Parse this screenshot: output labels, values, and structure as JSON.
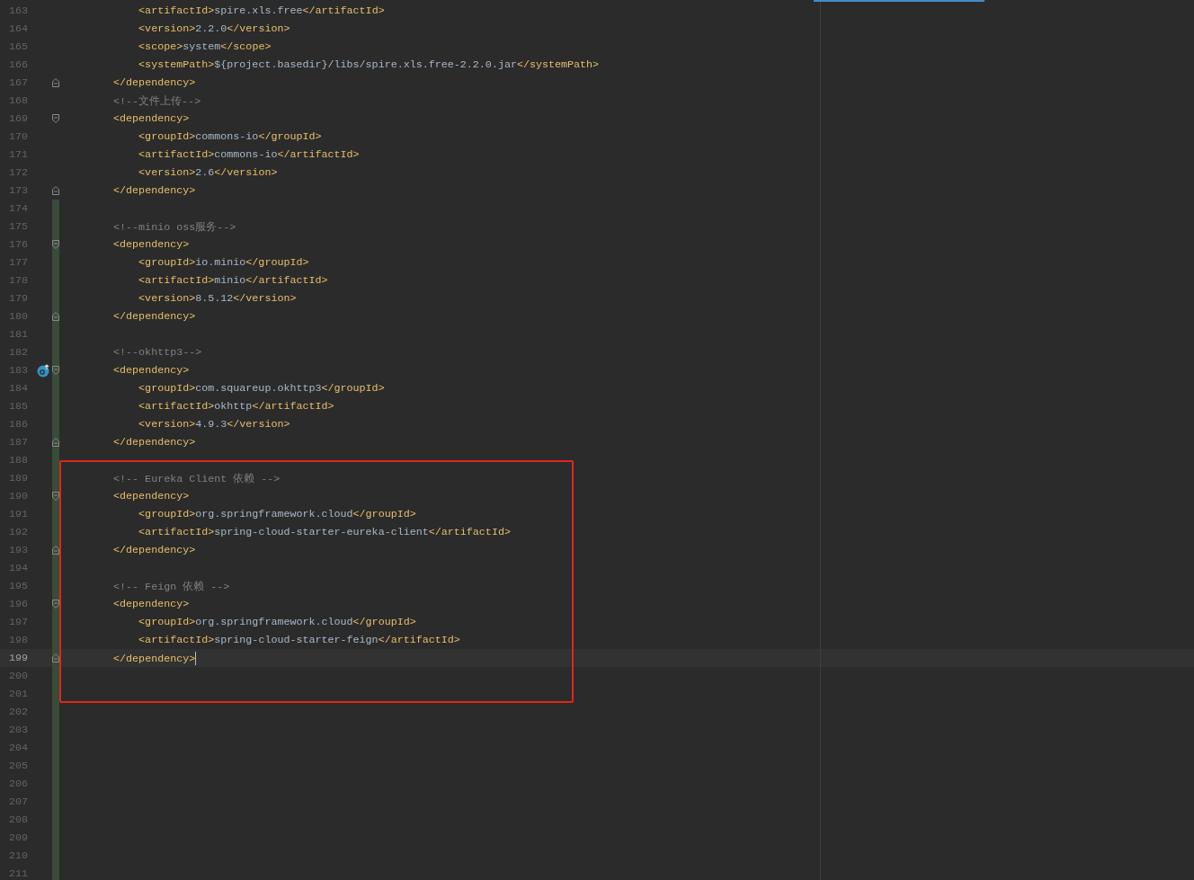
{
  "editor": {
    "lines": [
      {
        "number": "163",
        "kind": "xml",
        "code": "        <artifactId>spire.xls.free</artifactId>",
        "fold_start": false,
        "fold_end": false,
        "changed": false,
        "marker": false,
        "selected": false,
        "caret": false
      },
      {
        "number": "164",
        "kind": "xml",
        "code": "        <version>2.2.0</version>",
        "fold_start": false,
        "fold_end": false,
        "changed": false,
        "marker": false,
        "selected": false,
        "caret": false
      },
      {
        "number": "165",
        "kind": "xml",
        "code": "        <scope>system</scope>",
        "fold_start": false,
        "fold_end": false,
        "changed": false,
        "marker": false,
        "selected": false,
        "caret": false
      },
      {
        "number": "166",
        "kind": "xml",
        "code": "        <systemPath>${project.basedir}/libs/spire.xls.free-2.2.0.jar</systemPath>",
        "fold_start": false,
        "fold_end": false,
        "changed": false,
        "marker": false,
        "selected": false,
        "caret": false
      },
      {
        "number": "167",
        "kind": "xml",
        "code": "    </dependency>",
        "fold_start": false,
        "fold_end": true,
        "changed": false,
        "marker": false,
        "selected": false,
        "caret": false
      },
      {
        "number": "168",
        "kind": "comment",
        "code": "    <!--文件上传-->",
        "fold_start": false,
        "fold_end": false,
        "changed": false,
        "marker": false,
        "selected": false,
        "caret": false
      },
      {
        "number": "169",
        "kind": "xml",
        "code": "    <dependency>",
        "fold_start": true,
        "fold_end": false,
        "changed": false,
        "marker": false,
        "selected": false,
        "caret": false
      },
      {
        "number": "170",
        "kind": "xml",
        "code": "        <groupId>commons-io</groupId>",
        "fold_start": false,
        "fold_end": false,
        "changed": false,
        "marker": false,
        "selected": false,
        "caret": false
      },
      {
        "number": "171",
        "kind": "xml",
        "code": "        <artifactId>commons-io</artifactId>",
        "fold_start": false,
        "fold_end": false,
        "changed": false,
        "marker": false,
        "selected": false,
        "caret": false
      },
      {
        "number": "172",
        "kind": "xml",
        "code": "        <version>2.6</version>",
        "fold_start": false,
        "fold_end": false,
        "changed": false,
        "marker": false,
        "selected": false,
        "caret": false
      },
      {
        "number": "173",
        "kind": "xml",
        "code": "    </dependency>",
        "fold_start": false,
        "fold_end": true,
        "changed": false,
        "marker": false,
        "selected": false,
        "caret": false
      },
      {
        "number": "174",
        "kind": "blank",
        "fold_start": false,
        "fold_end": false,
        "changed": true,
        "marker": false,
        "selected": false,
        "caret": false
      },
      {
        "number": "175",
        "kind": "comment",
        "code": "    <!--minio oss服务-->",
        "fold_start": false,
        "fold_end": false,
        "changed": true,
        "marker": false,
        "selected": false,
        "caret": false
      },
      {
        "number": "176",
        "kind": "xml",
        "code": "    <dependency>",
        "fold_start": true,
        "fold_end": false,
        "changed": true,
        "marker": false,
        "selected": false,
        "caret": false
      },
      {
        "number": "177",
        "kind": "xml",
        "code": "        <groupId>io.minio</groupId>",
        "fold_start": false,
        "fold_end": false,
        "changed": true,
        "marker": false,
        "selected": false,
        "caret": false
      },
      {
        "number": "178",
        "kind": "xml",
        "code": "        <artifactId>minio</artifactId>",
        "fold_start": false,
        "fold_end": false,
        "changed": true,
        "marker": false,
        "selected": false,
        "caret": false
      },
      {
        "number": "179",
        "kind": "xml",
        "code": "        <version>8.5.12</version>",
        "fold_start": false,
        "fold_end": false,
        "changed": true,
        "marker": false,
        "selected": false,
        "caret": false
      },
      {
        "number": "180",
        "kind": "xml",
        "code": "    </dependency>",
        "fold_start": false,
        "fold_end": true,
        "changed": true,
        "marker": false,
        "selected": false,
        "caret": false
      },
      {
        "number": "181",
        "kind": "blank",
        "fold_start": false,
        "fold_end": false,
        "changed": true,
        "marker": false,
        "selected": false,
        "caret": false
      },
      {
        "number": "182",
        "kind": "comment",
        "code": "    <!--okhttp3-->",
        "fold_start": false,
        "fold_end": false,
        "changed": true,
        "marker": false,
        "selected": false,
        "caret": false
      },
      {
        "number": "183",
        "kind": "xml",
        "code": "    <dependency>",
        "fold_start": true,
        "fold_end": false,
        "changed": true,
        "marker": true,
        "selected": false,
        "caret": false
      },
      {
        "number": "184",
        "kind": "xml",
        "code": "        <groupId>com.squareup.okhttp3</groupId>",
        "fold_start": false,
        "fold_end": false,
        "changed": true,
        "marker": false,
        "selected": false,
        "caret": false
      },
      {
        "number": "185",
        "kind": "xml",
        "code": "        <artifactId>okhttp</artifactId>",
        "fold_start": false,
        "fold_end": false,
        "changed": true,
        "marker": false,
        "selected": false,
        "caret": false
      },
      {
        "number": "186",
        "kind": "xml",
        "code": "        <version>4.9.3</version>",
        "fold_start": false,
        "fold_end": false,
        "changed": true,
        "marker": false,
        "selected": false,
        "caret": false
      },
      {
        "number": "187",
        "kind": "xml",
        "code": "    </dependency>",
        "fold_start": false,
        "fold_end": true,
        "changed": true,
        "marker": false,
        "selected": false,
        "caret": false
      },
      {
        "number": "188",
        "kind": "blank",
        "fold_start": false,
        "fold_end": false,
        "changed": true,
        "marker": false,
        "selected": false,
        "caret": false
      },
      {
        "number": "189",
        "kind": "comment",
        "code": "    <!-- Eureka Client 依赖 -->",
        "fold_start": false,
        "fold_end": false,
        "changed": true,
        "marker": false,
        "selected": false,
        "caret": false
      },
      {
        "number": "190",
        "kind": "xml",
        "code": "    <dependency>",
        "fold_start": true,
        "fold_end": false,
        "changed": true,
        "marker": false,
        "selected": false,
        "caret": false
      },
      {
        "number": "191",
        "kind": "xml",
        "code": "        <groupId>org.springframework.cloud</groupId>",
        "fold_start": false,
        "fold_end": false,
        "changed": true,
        "marker": false,
        "selected": false,
        "caret": false
      },
      {
        "number": "192",
        "kind": "xml",
        "code": "        <artifactId>spring-cloud-starter-eureka-client</artifactId>",
        "fold_start": false,
        "fold_end": false,
        "changed": true,
        "marker": false,
        "selected": false,
        "caret": false
      },
      {
        "number": "193",
        "kind": "xml",
        "code": "    </dependency>",
        "fold_start": false,
        "fold_end": true,
        "changed": true,
        "marker": false,
        "selected": false,
        "caret": false
      },
      {
        "number": "194",
        "kind": "blank",
        "fold_start": false,
        "fold_end": false,
        "changed": true,
        "marker": false,
        "selected": false,
        "caret": false
      },
      {
        "number": "195",
        "kind": "comment",
        "code": "    <!-- Feign 依赖 -->",
        "fold_start": false,
        "fold_end": false,
        "changed": true,
        "marker": false,
        "selected": false,
        "caret": false
      },
      {
        "number": "196",
        "kind": "xml",
        "code": "    <dependency>",
        "fold_start": true,
        "fold_end": false,
        "changed": true,
        "marker": false,
        "selected": false,
        "caret": false
      },
      {
        "number": "197",
        "kind": "xml",
        "code": "        <groupId>org.springframework.cloud</groupId>",
        "fold_start": false,
        "fold_end": false,
        "changed": true,
        "marker": false,
        "selected": false,
        "caret": false
      },
      {
        "number": "198",
        "kind": "xml",
        "code": "        <artifactId>spring-cloud-starter-feign</artifactId>",
        "fold_start": false,
        "fold_end": false,
        "changed": true,
        "marker": false,
        "selected": false,
        "caret": false
      },
      {
        "number": "199",
        "kind": "xml",
        "code": "    </dependency>",
        "fold_start": false,
        "fold_end": true,
        "changed": true,
        "marker": false,
        "selected": true,
        "caret": true
      },
      {
        "number": "200",
        "kind": "blank",
        "fold_start": false,
        "fold_end": false,
        "changed": true,
        "marker": false,
        "selected": false,
        "caret": false
      },
      {
        "number": "201",
        "kind": "blank",
        "fold_start": false,
        "fold_end": false,
        "changed": true,
        "marker": false,
        "selected": false,
        "caret": false
      },
      {
        "number": "202",
        "kind": "blank",
        "fold_start": false,
        "fold_end": false,
        "changed": true,
        "marker": false,
        "selected": false,
        "caret": false
      },
      {
        "number": "203",
        "kind": "blank",
        "fold_start": false,
        "fold_end": false,
        "changed": true,
        "marker": false,
        "selected": false,
        "caret": false
      },
      {
        "number": "204",
        "kind": "blank",
        "fold_start": false,
        "fold_end": false,
        "changed": true,
        "marker": false,
        "selected": false,
        "caret": false
      },
      {
        "number": "205",
        "kind": "blank",
        "fold_start": false,
        "fold_end": false,
        "changed": true,
        "marker": false,
        "selected": false,
        "caret": false
      },
      {
        "number": "206",
        "kind": "blank",
        "fold_start": false,
        "fold_end": false,
        "changed": true,
        "marker": false,
        "selected": false,
        "caret": false
      },
      {
        "number": "207",
        "kind": "blank",
        "fold_start": false,
        "fold_end": false,
        "changed": true,
        "marker": false,
        "selected": false,
        "caret": false
      },
      {
        "number": "208",
        "kind": "blank",
        "fold_start": false,
        "fold_end": false,
        "changed": true,
        "marker": false,
        "selected": false,
        "caret": false
      },
      {
        "number": "209",
        "kind": "blank",
        "fold_start": false,
        "fold_end": false,
        "changed": true,
        "marker": false,
        "selected": false,
        "caret": false
      },
      {
        "number": "210",
        "kind": "blank",
        "fold_start": false,
        "fold_end": false,
        "changed": true,
        "marker": false,
        "selected": false,
        "caret": false
      },
      {
        "number": "211",
        "kind": "blank",
        "fold_start": false,
        "fold_end": false,
        "changed": true,
        "marker": false,
        "selected": false,
        "caret": false
      }
    ]
  }
}
